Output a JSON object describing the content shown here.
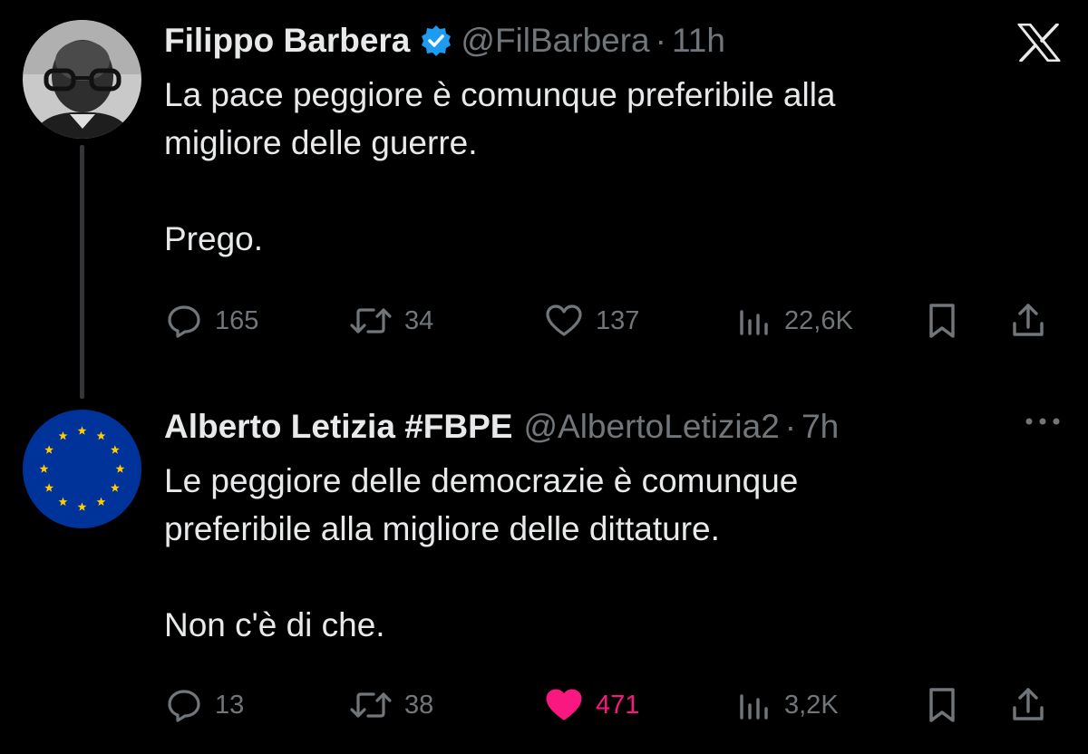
{
  "tweets": [
    {
      "author_name": "Filippo Barbera",
      "verified": true,
      "handle": "@FilBarbera",
      "separator": "·",
      "time": "11h",
      "text_lines": [
        "La pace peggiore è comunque preferibile alla",
        "migliore delle guerre.",
        "",
        "Prego."
      ],
      "stats": {
        "replies": "165",
        "retweets": "34",
        "likes": "137",
        "views": "22,6K"
      },
      "liked": false,
      "avatar_icon": "user-photo-avatar"
    },
    {
      "author_name": "Alberto Letizia #FBPE",
      "verified": false,
      "handle": "@AlbertoLetizia2",
      "separator": "·",
      "time": "7h",
      "text_lines": [
        "Le peggiore delle democrazie è comunque",
        "preferibile alla migliore delle dittature.",
        "",
        "Non c'è di che."
      ],
      "stats": {
        "replies": "13",
        "retweets": "38",
        "likes": "471",
        "views": "3,2K"
      },
      "liked": true,
      "avatar_icon": "eu-flag-avatar"
    }
  ],
  "colors": {
    "background": "#000000",
    "text_primary": "#e7e9ea",
    "text_secondary": "#71767b",
    "verified_blue": "#1d9bf0",
    "like_pink": "#f91880",
    "eu_blue": "#003399",
    "eu_gold": "#ffcc00"
  },
  "icons": {
    "app_logo": "x-logo-icon",
    "more": "more-options-icon",
    "reply": "reply-icon",
    "retweet": "retweet-icon",
    "like": "heart-icon",
    "views": "views-icon",
    "bookmark": "bookmark-icon",
    "share": "share-icon"
  }
}
